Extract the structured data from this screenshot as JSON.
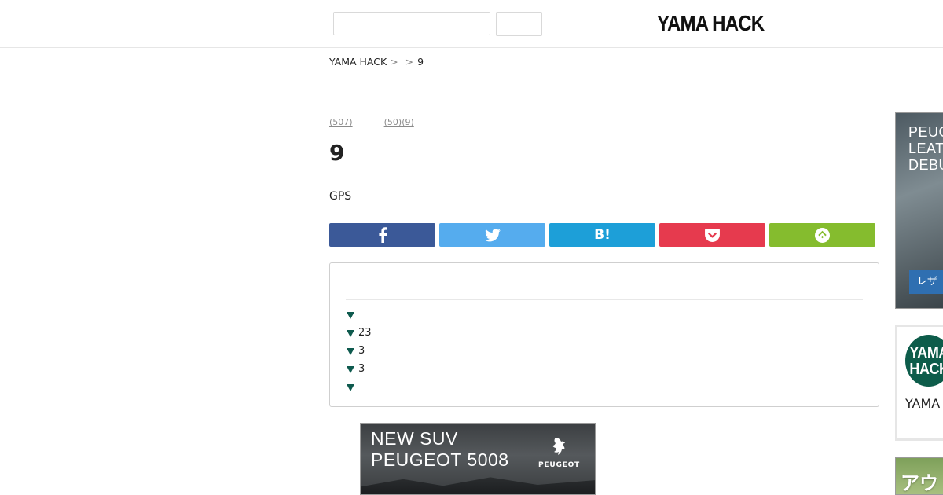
{
  "header": {
    "search_placeholder": "",
    "search_button_label": "",
    "logo_text": "YAMA HACK"
  },
  "breadcrumb": {
    "items": [
      "YAMA HACK",
      "",
      "9"
    ],
    "separator": ">"
  },
  "tags": [
    "(507)",
    "(50)",
    "(9)"
  ],
  "article": {
    "title": "9",
    "lead": "GPS"
  },
  "share": {
    "facebook_icon": "facebook-icon",
    "twitter_icon": "twitter-icon",
    "hatena_label": "B!",
    "pocket_icon": "pocket-icon",
    "feedly_icon": "feedly-icon",
    "colors": {
      "facebook": "#3b5998",
      "twitter": "#55acee",
      "hatena": "#1d9fd8",
      "pocket": "#e63a4e",
      "feedly": "#85bc2e"
    }
  },
  "toc": {
    "title": "",
    "items": [
      "",
      "23",
      "3",
      "3",
      ""
    ],
    "marker_color": "#0e5a4e"
  },
  "ads": {
    "bottom": {
      "line1": "NEW SUV",
      "line2": "PEUGEOT 5008",
      "brand": "PEUGEOT"
    },
    "right_top": {
      "lines": [
        "PEUG",
        "LEAT",
        "DEBU"
      ],
      "cta": "レザ"
    },
    "right_bottom": {
      "text": "アウ"
    }
  },
  "profile": {
    "avatar_text_1": "YAMA",
    "avatar_text_2": "HACK",
    "name": "YAMA"
  }
}
